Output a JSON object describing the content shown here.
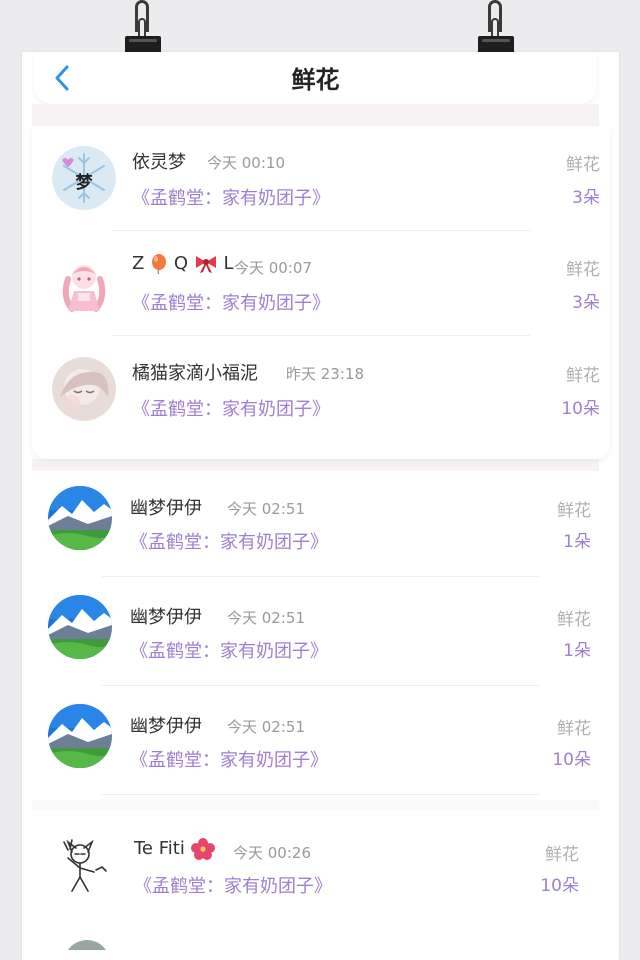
{
  "header": {
    "title": "鲜花"
  },
  "records": [
    {
      "name": "依灵梦",
      "time": "今天 00:10",
      "book": "《孟鹤堂：家有奶团子》",
      "gift": "鲜花",
      "count": "3朵"
    },
    {
      "name_prefix": "Z",
      "name_mid": "Q",
      "name_suffix": "L",
      "time": "今天 00:07",
      "book": "《孟鹤堂：家有奶团子》",
      "gift": "鲜花",
      "count": "3朵"
    },
    {
      "name": "橘猫家滴小福泥",
      "time": "昨天 23:18",
      "book": "《孟鹤堂：家有奶团子》",
      "gift": "鲜花",
      "count": "10朵"
    },
    {
      "name": "幽梦伊伊",
      "time": "今天 02:51",
      "book": "《孟鹤堂：家有奶团子》",
      "gift": "鲜花",
      "count": "1朵"
    },
    {
      "name": "幽梦伊伊",
      "time": "今天 02:51",
      "book": "《孟鹤堂：家有奶团子》",
      "gift": "鲜花",
      "count": "1朵"
    },
    {
      "name": "幽梦伊伊",
      "time": "今天 02:51",
      "book": "《孟鹤堂：家有奶团子》",
      "gift": "鲜花",
      "count": "10朵"
    },
    {
      "name": "Te Fiti",
      "time": "今天 00:26",
      "book": "《孟鹤堂：家有奶团子》",
      "gift": "鲜花",
      "count": "10朵"
    }
  ],
  "avatar_text": {
    "meng": "梦"
  },
  "colors": {
    "accent": "#a07fd0",
    "back": "#2f8ff2",
    "muted": "#9a9a9a"
  }
}
